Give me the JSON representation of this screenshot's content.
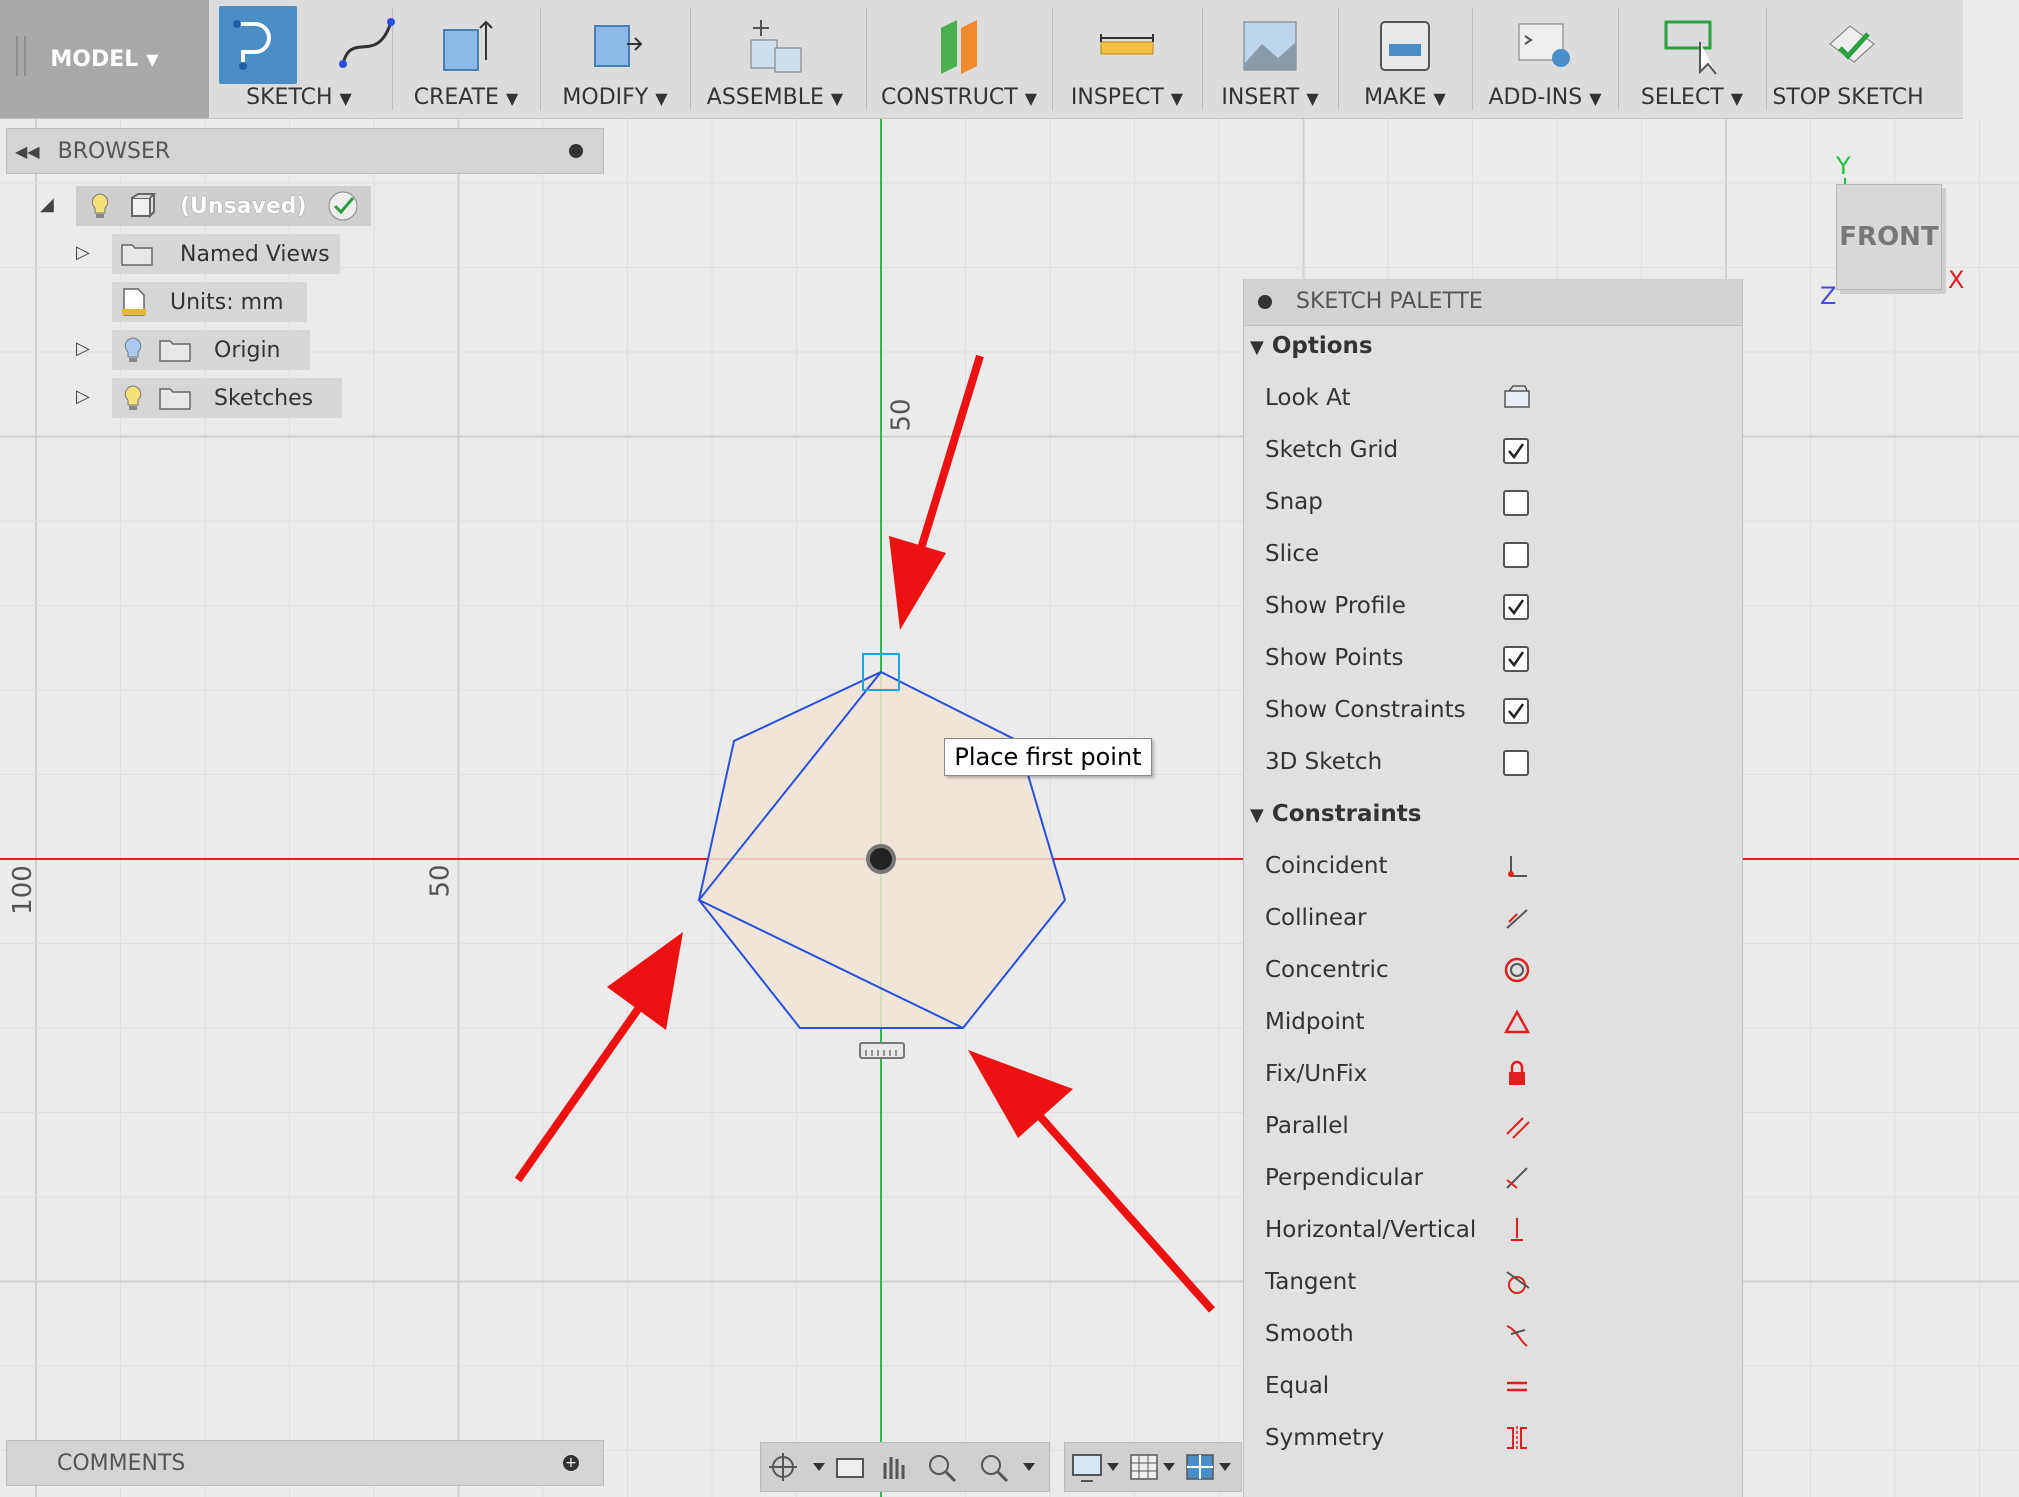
{
  "toolbar": {
    "workspace": "MODEL",
    "groups": [
      {
        "label": "SKETCH",
        "icon": "sketch-icon"
      },
      {
        "label": "CREATE",
        "icon": "create-icon"
      },
      {
        "label": "MODIFY",
        "icon": "modify-icon"
      },
      {
        "label": "ASSEMBLE",
        "icon": "assemble-icon"
      },
      {
        "label": "CONSTRUCT",
        "icon": "construct-icon"
      },
      {
        "label": "INSPECT",
        "icon": "inspect-icon"
      },
      {
        "label": "INSERT",
        "icon": "insert-icon"
      },
      {
        "label": "MAKE",
        "icon": "make-icon"
      },
      {
        "label": "ADD-INS",
        "icon": "add-ins-icon"
      },
      {
        "label": "SELECT",
        "icon": "select-icon"
      },
      {
        "label": "STOP SKETCH",
        "icon": "stop-sketch-icon"
      }
    ]
  },
  "browser": {
    "title": "BROWSER",
    "root": "(Unsaved)",
    "items": [
      {
        "label": "Named Views"
      },
      {
        "label": "Units: mm"
      },
      {
        "label": "Origin"
      },
      {
        "label": "Sketches"
      }
    ]
  },
  "canvas": {
    "tooltip": "Place first point",
    "axis_labels": {
      "top_y": "50",
      "left_x": "50",
      "far_left": "100"
    },
    "colors": {
      "x_axis": "#e02020",
      "y_axis": "#20c040",
      "sketch_line": "#2a4fe0",
      "profile_fill": "#f1e4d6",
      "arrow": "#ee1111"
    }
  },
  "viewcube": {
    "face": "FRONT",
    "y": "Y",
    "x": "X",
    "z": "Z"
  },
  "palette": {
    "title": "SKETCH PALETTE",
    "options_title": "Options",
    "options": [
      {
        "label": "Look At",
        "control": "icon"
      },
      {
        "label": "Sketch Grid",
        "checked": true
      },
      {
        "label": "Snap",
        "checked": false
      },
      {
        "label": "Slice",
        "checked": false
      },
      {
        "label": "Show Profile",
        "checked": true
      },
      {
        "label": "Show Points",
        "checked": true
      },
      {
        "label": "Show Constraints",
        "checked": true
      },
      {
        "label": "3D Sketch",
        "checked": false
      }
    ],
    "constraints_title": "Constraints",
    "constraints": [
      {
        "label": "Coincident",
        "icon": "coincident-icon"
      },
      {
        "label": "Collinear",
        "icon": "collinear-icon"
      },
      {
        "label": "Concentric",
        "icon": "concentric-icon"
      },
      {
        "label": "Midpoint",
        "icon": "midpoint-icon"
      },
      {
        "label": "Fix/UnFix",
        "icon": "lock-icon"
      },
      {
        "label": "Parallel",
        "icon": "parallel-icon"
      },
      {
        "label": "Perpendicular",
        "icon": "perpendicular-icon"
      },
      {
        "label": "Horizontal/Vertical",
        "icon": "horizontal-vertical-icon"
      },
      {
        "label": "Tangent",
        "icon": "tangent-icon"
      },
      {
        "label": "Smooth",
        "icon": "smooth-icon"
      },
      {
        "label": "Equal",
        "icon": "equal-icon"
      },
      {
        "label": "Symmetry",
        "icon": "symmetry-icon"
      }
    ]
  },
  "comments": {
    "title": "COMMENTS"
  }
}
